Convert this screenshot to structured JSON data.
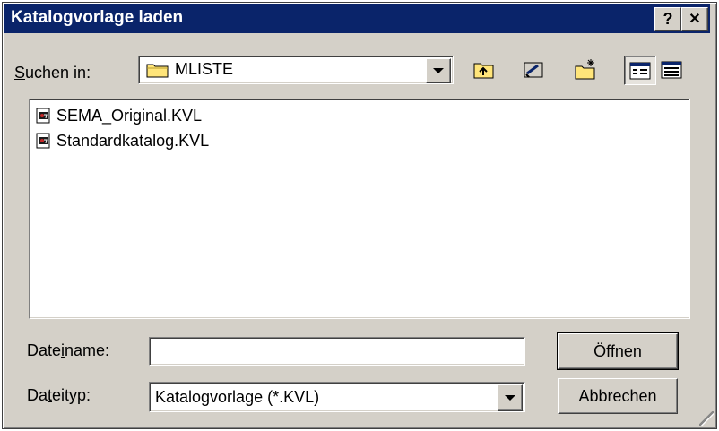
{
  "window": {
    "title": "Katalogvorlage laden",
    "help_button": "?",
    "close_button": "✕"
  },
  "lookin": {
    "label_prefix": "",
    "label_underlined": "S",
    "label_suffix": "uchen in:",
    "value": "MLISTE"
  },
  "toolbar": {
    "icons": [
      "up-one-level-icon",
      "desktop-icon",
      "new-folder-icon",
      "list-view-icon",
      "details-view-icon"
    ]
  },
  "files": {
    "items": [
      {
        "name": "SEMA_Original.KVL",
        "icon": "kvl-file-icon"
      },
      {
        "name": "Standardkatalog.KVL",
        "icon": "kvl-file-icon"
      }
    ]
  },
  "filename": {
    "label_prefix": "Date",
    "label_underlined": "i",
    "label_suffix": "name:",
    "value": ""
  },
  "filetype": {
    "label_prefix": "Da",
    "label_underlined": "t",
    "label_suffix": "eityp:",
    "value": "Katalogvorlage (*.KVL)"
  },
  "buttons": {
    "open_prefix": "Ö",
    "open_underlined": "f",
    "open_suffix": "fnen",
    "cancel": "Abbrechen"
  }
}
